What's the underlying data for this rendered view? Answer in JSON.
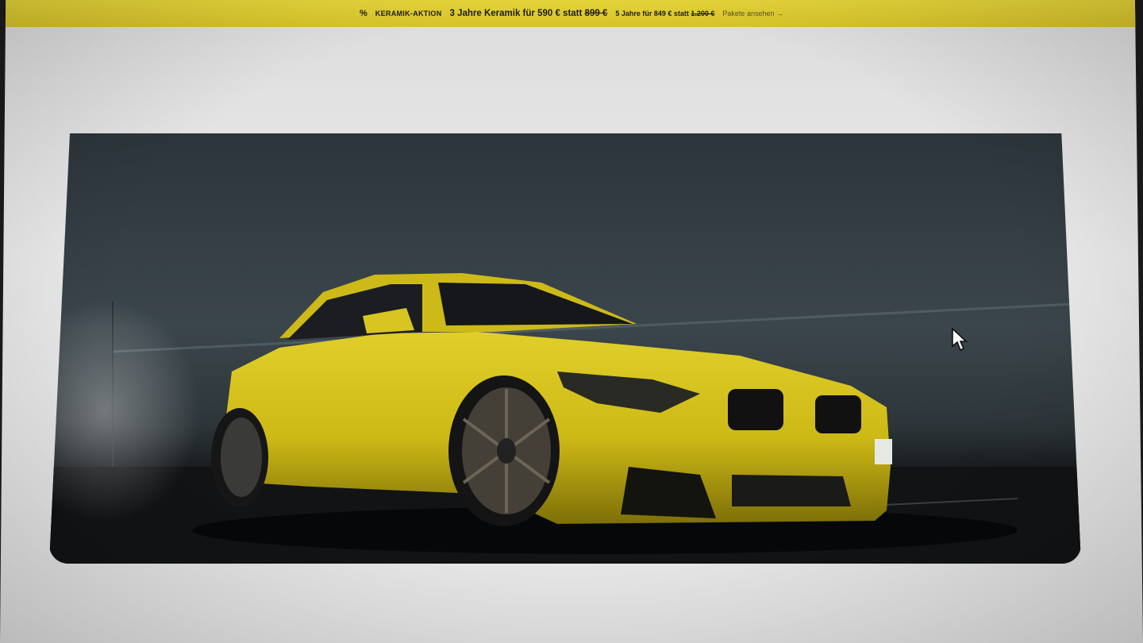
{
  "promo_banner": {
    "icon": "percent-icon",
    "label": "KERAMIK-AKTION",
    "headline_prefix": "3 Jahre Keramik für 590 € statt",
    "headline_old_price": "899 €",
    "secondary_prefix": "5 Jahre für 849 € statt",
    "secondary_old_price": "1.200 €",
    "cta": "Pakete ansehen →",
    "background_color": "#d9c72e"
  },
  "hero": {
    "image": "yellow-bmw-coupe-photo",
    "car_color": "#d4c21d"
  },
  "cursor": {
    "icon": "mouse-pointer-icon"
  }
}
